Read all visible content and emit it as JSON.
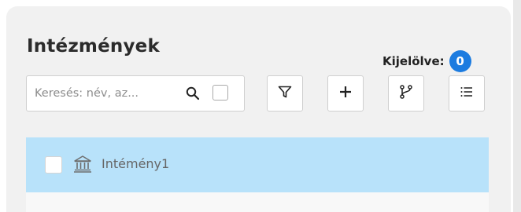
{
  "panel": {
    "title": "Intézmények",
    "selected_label": "Kijelölve:",
    "selected_count": "0"
  },
  "toolbar": {
    "search_placeholder": "Keresés: név, az...",
    "search_icon": "search-icon",
    "filter_icon": "filter-icon",
    "add_icon": "plus-icon",
    "branch_icon": "branch-icon",
    "list_icon": "list-icon"
  },
  "list": {
    "items": [
      {
        "label": "Intémény1",
        "icon": "institution-icon",
        "checked": false,
        "selected": true
      }
    ]
  },
  "colors": {
    "accent": "#1b7be0",
    "selected_row": "#b8e2fa",
    "panel_bg": "#f1f1f1"
  }
}
